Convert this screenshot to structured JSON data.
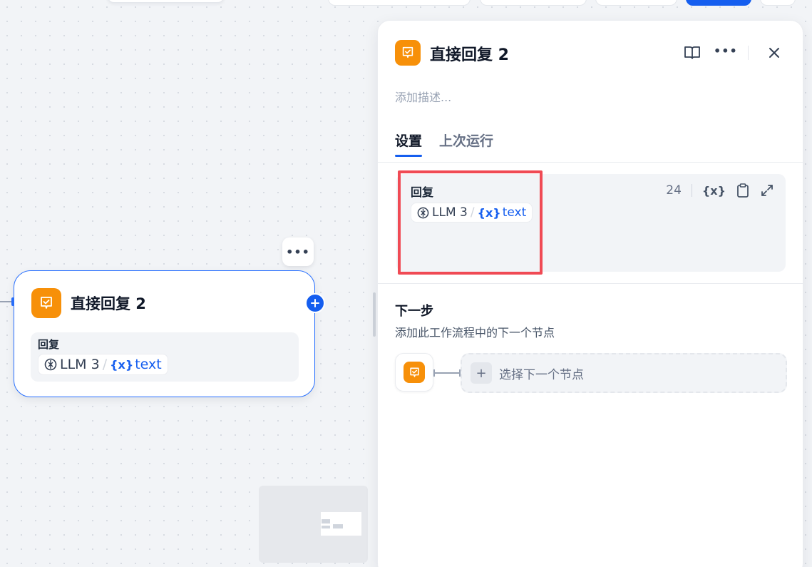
{
  "node": {
    "title": "直接回复 2",
    "body_label": "回复",
    "var_source": "LLM 3",
    "var_separator": "/",
    "var_icon_text": "{x}",
    "var_name": "text",
    "more_text": "•••"
  },
  "panel": {
    "title": "直接回复 2",
    "more_text": "•••",
    "description_placeholder": "添加描述...",
    "tabs": [
      {
        "label": "设置",
        "active": true
      },
      {
        "label": "上次运行",
        "active": false
      }
    ],
    "answer": {
      "label": "回复",
      "var_source": "LLM 3",
      "var_separator": "/",
      "var_icon_text": "{x}",
      "var_name": "text",
      "char_count": "24",
      "var_tool_text": "{x}"
    },
    "next_step": {
      "title": "下一步",
      "description": "添加此工作流程中的下一个节点",
      "select_plus": "+",
      "select_label": "选择下一个节点"
    }
  },
  "colors": {
    "accent": "#155eef",
    "node_icon": "#f79009",
    "highlight": "#f04a54"
  },
  "icons": {
    "node": "answer-check-icon",
    "llm": "llm-model-icon",
    "book": "book-open-icon",
    "close": "close-icon",
    "copy": "clipboard-icon",
    "expand": "expand-icon",
    "add": "plus-icon"
  }
}
